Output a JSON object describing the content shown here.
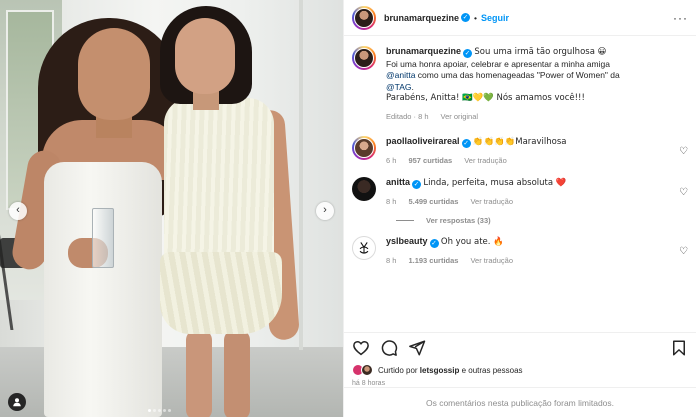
{
  "header": {
    "username": "brunamarquezine",
    "verified_glyph": "✓",
    "separator": "•",
    "follow_label": "Seguir",
    "more_glyph": "···"
  },
  "media": {
    "nav_prev": "‹",
    "nav_next": "›",
    "tag_glyph": "●",
    "slide_count": 5,
    "active_slide": 1
  },
  "caption": {
    "username": "brunamarquezine",
    "line1": "Sou uma irmã tão orgulhosa 😀",
    "line2_pre": "Foi uma honra apoiar, celebrar e apresentar a minha amiga",
    "mention1": "@anitta",
    "line3_post": " como uma das homenageadas \"Power of Women\" da",
    "mention2": "@TAG",
    "line4_post": ".",
    "line5": "Parabéns, Anitta! 🇧🇷💛💚 Nós amamos você!!!",
    "meta_edited": "Editado · 8 h",
    "meta_translate": "Ver original"
  },
  "comments": [
    {
      "username": "paollaoliveirareal",
      "text": "👏👏👏👏Maravilhosa",
      "time": "6 h",
      "likes": "957 curtidas",
      "translate": "Ver tradução"
    },
    {
      "username": "anitta",
      "text": "Linda, perfeita, musa absoluta ❤️",
      "time": "8 h",
      "likes": "5.499 curtidas",
      "translate": "Ver tradução",
      "replies": "Ver respostas (33)"
    },
    {
      "username": "yslbeauty",
      "text": "Oh you ate. 🔥",
      "time": "8 h",
      "likes": "1.193 curtidas",
      "translate": "Ver tradução"
    }
  ],
  "likes": {
    "prefix": "Curtido por ",
    "user": "letsgossip",
    "suffix": " e outras pessoas"
  },
  "timestamp": "há 8 horas",
  "limited_notice": "Os comentários nesta publicação foram limitados.",
  "icons": {
    "heart": "♡",
    "colors": {
      "accent": "#0095f6",
      "muted": "#8e8e8e",
      "text": "#262626"
    }
  }
}
